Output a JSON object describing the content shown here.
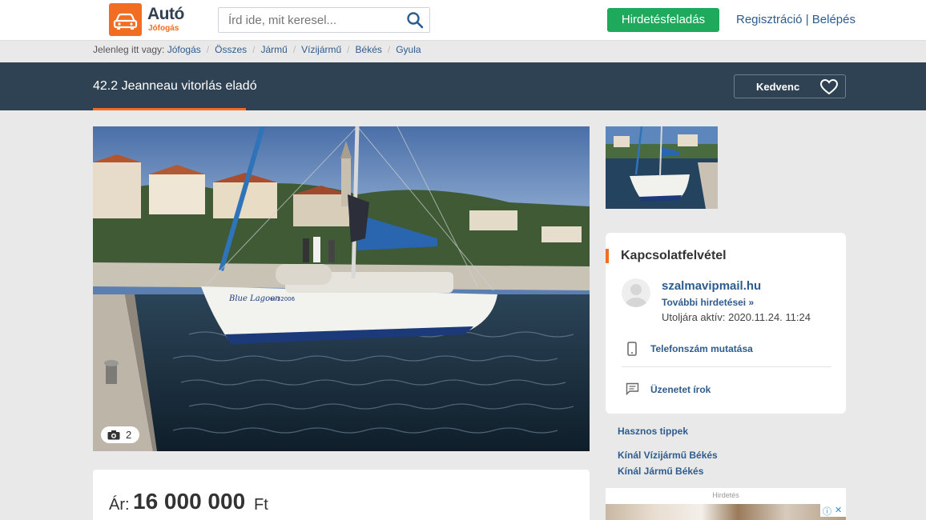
{
  "header": {
    "logo_title": "Autó",
    "logo_subtitle": "Jófogás",
    "search_placeholder": "Írd ide, mit keresel...",
    "post_button": "Hirdetésfeladás",
    "register": "Regisztráció",
    "auth_separator": " | ",
    "login": "Belépés"
  },
  "breadcrumb": {
    "prefix": "Jelenleg itt vagy:",
    "items": [
      "Jófogás",
      "Összes",
      "Jármű",
      "Vízijármű",
      "Békés",
      "Gyula"
    ]
  },
  "listing": {
    "title": "42.2 Jeanneau vitorlás eladó",
    "favorite_label": "Kedvenc",
    "photo_count": "2",
    "boat_name": "Blue Lagoon",
    "boat_reg": "H-32006",
    "price_label": "Ár:",
    "price_value": "16 000 000",
    "price_currency": "Ft"
  },
  "contact": {
    "title": "Kapcsolatfelvétel",
    "seller_name": "szalmavipmail.hu",
    "more_ads": "További hirdetései »",
    "last_active": "Utoljára aktív: 2020.11.24. 11:24",
    "phone": "Telefonszám mutatása",
    "message": "Üzenetet írok"
  },
  "side_links": {
    "tips": "Hasznos tippek",
    "offer_water": "Kínál Vízijármű Békés",
    "offer_vehicle": "Kínál Jármű Békés"
  },
  "ad": {
    "label": "Hirdetés",
    "info_icon": "ⓘ",
    "close_icon": "✕"
  },
  "colors": {
    "brand_orange": "#f26c22",
    "title_bar": "#2f4254",
    "post_green": "#1fa95c",
    "link_blue": "#2d5c8f"
  }
}
